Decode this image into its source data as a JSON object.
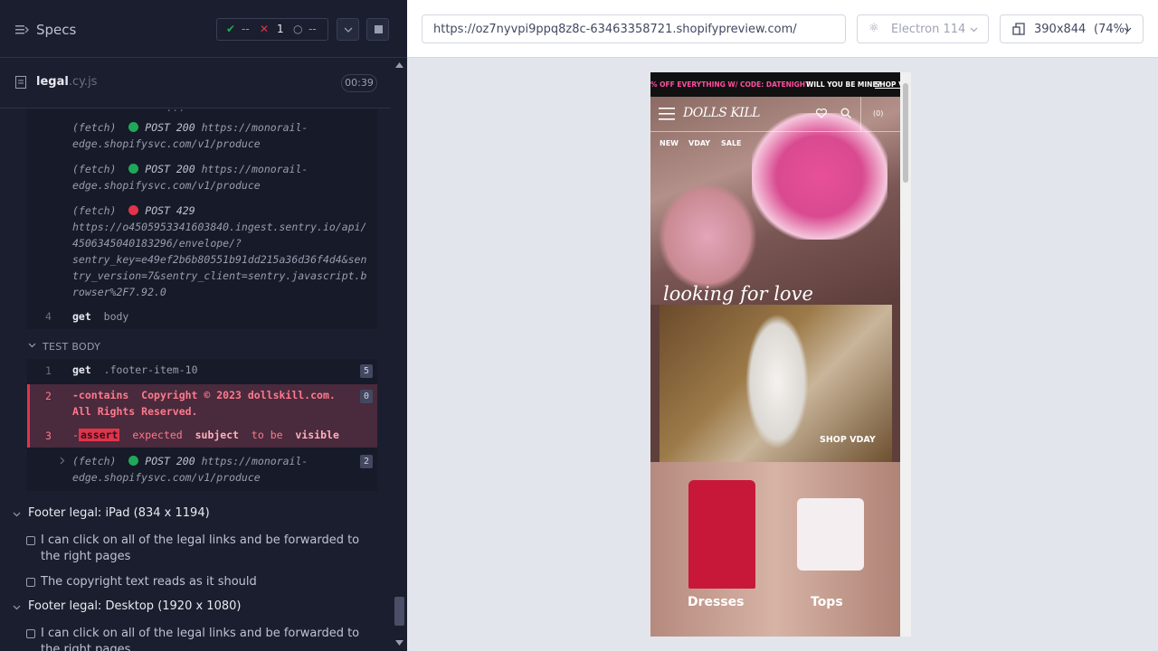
{
  "header": {
    "title": "Specs",
    "passed": "--",
    "failed": "1",
    "pending": "--"
  },
  "file": {
    "name": "legal",
    "ext": ".cy.js",
    "duration": "00:39"
  },
  "commands": {
    "log": [
      {
        "type": "(fetch)",
        "status": "POST 200",
        "url_lines": [
          "https://monorail-",
          "edge.shopifysvc.com/v1/produce"
        ],
        "color": "#20a85a"
      },
      {
        "type": "(fetch)",
        "status": "POST 200",
        "url_lines": [
          "https://monorail-",
          "edge.shopifysvc.com/v1/produce"
        ],
        "color": "#20a85a"
      },
      {
        "type": "(fetch)",
        "status": "POST 429",
        "url_lines": [
          "https://o4505953341603840.ingest.sentry.io/api/",
          "4506345040183296/envelope/?",
          "sentry_key=e49ef2b6b80551b91dd215a36d36f4d4&sen",
          "try_version=7&sentry_client=sentry.javascript.b",
          "rowser%2F7.92.0"
        ],
        "color": "#e0344a"
      }
    ],
    "get_body": {
      "num": "4",
      "cmd": "get",
      "arg": "body"
    }
  },
  "test_body": {
    "label": "TEST BODY",
    "rows": [
      {
        "num": "1",
        "cmd": "get",
        "arg": ".footer-item-10",
        "badge": "5"
      },
      {
        "num": "2",
        "cmd": "-contains",
        "arg_lines": [
          "Copyright © 2023 dollskill.com.",
          "All Rights Reserved."
        ],
        "badge": "0"
      },
      {
        "num": "3",
        "cmd": "-",
        "tag": "assert",
        "words": [
          "expected",
          "subject",
          "to be",
          "visible"
        ]
      },
      {
        "type": "(fetch)",
        "status": "POST 200",
        "url_lines": [
          "https://monorail-",
          "edge.shopifysvc.com/v1/produce"
        ],
        "badge": "2",
        "color": "#20a85a"
      }
    ]
  },
  "suites": [
    {
      "title": "Footer legal: iPad (834 x 1194)",
      "tests": [
        "I can click on all of the legal links and be forwarded to the right pages",
        "The copyright text reads as it should"
      ]
    },
    {
      "title": "Footer legal: Desktop (1920 x 1080)",
      "tests": [
        "I can click on all of the legal links and be forwarded to the right pages"
      ]
    }
  ],
  "browser": {
    "url": "https://oz7nyvpi9ppq8z8c-63463358721.shopifypreview.com/",
    "name": "Electron 114",
    "viewport": "390x844",
    "zoom": "(74%)"
  },
  "site": {
    "promo_left": "% OFF EVERYTHING W/ CODE: DATENIGHT",
    "promo_right": "WILL YOU BE MINE?",
    "promo_link": "SHOP V",
    "logo": "DOLLS KILL",
    "nav": [
      "NEW",
      "VDAY",
      "SALE"
    ],
    "bag_count": "(0)",
    "hero_text": "looking for love",
    "card_cta": "SHOP VDAY",
    "cat_left": "Dresses",
    "cat_right": "Tops"
  }
}
